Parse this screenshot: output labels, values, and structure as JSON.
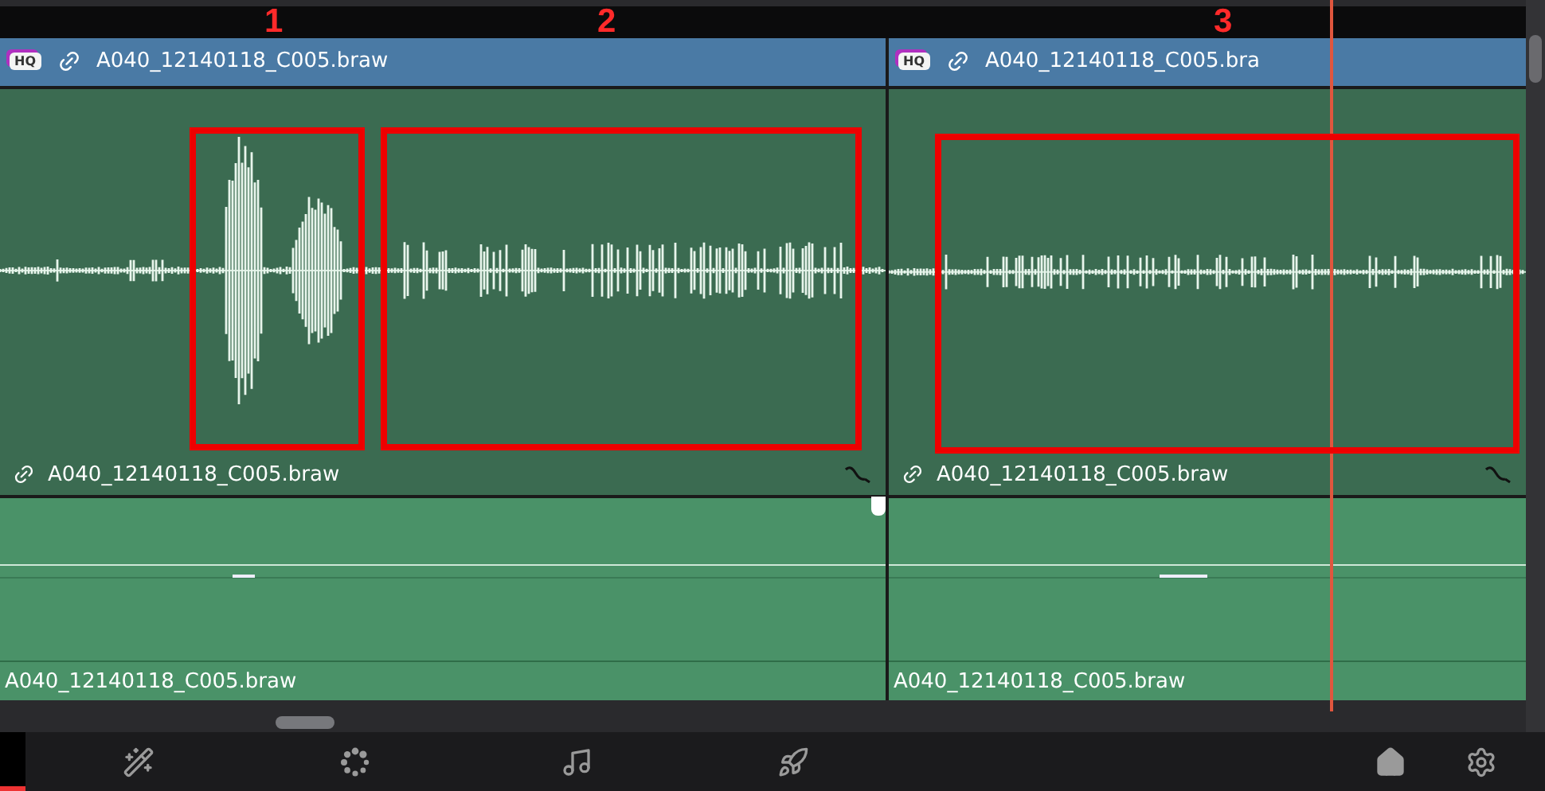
{
  "video_track": {
    "clips": [
      {
        "badge": "HQ",
        "name": "A040_12140118_C005.braw"
      },
      {
        "badge": "HQ",
        "name": "A040_12140118_C005.bra"
      }
    ]
  },
  "audio_track_1": {
    "clips": [
      {
        "name": "A040_12140118_C005.braw",
        "loud": true
      },
      {
        "name": "A040_12140118_C005.braw",
        "loud": false
      }
    ]
  },
  "audio_track_2": {
    "clips": [
      {
        "name": "A040_12140118_C005.braw"
      },
      {
        "name": "A040_12140118_C005.braw"
      }
    ]
  },
  "annotations": [
    {
      "label": "1"
    },
    {
      "label": "2"
    },
    {
      "label": "3"
    }
  ],
  "toolbar": {
    "buttons": [
      {
        "kind": "effects"
      },
      {
        "kind": "color"
      },
      {
        "kind": "audio"
      },
      {
        "kind": "deliver"
      },
      {
        "kind": "home"
      },
      {
        "kind": "settings"
      }
    ]
  }
}
